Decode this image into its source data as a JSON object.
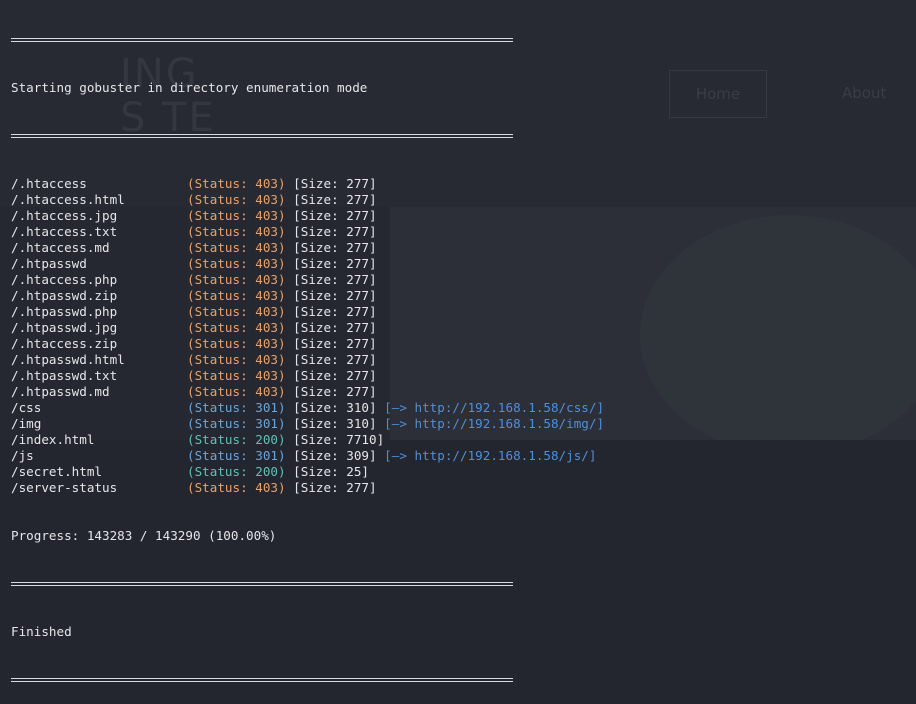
{
  "background": {
    "hero_text_line1": "ING",
    "hero_text_line2": "S TE",
    "nav_home": "Home",
    "nav_about": "About"
  },
  "terminal": {
    "header": "Starting gobuster in directory enumeration mode",
    "results": [
      {
        "path": "/.htaccess",
        "status": "(Status: 403)",
        "code": "403",
        "size": "[Size: 277]",
        "redirect": ""
      },
      {
        "path": "/.htaccess.html",
        "status": "(Status: 403)",
        "code": "403",
        "size": "[Size: 277]",
        "redirect": ""
      },
      {
        "path": "/.htaccess.jpg",
        "status": "(Status: 403)",
        "code": "403",
        "size": "[Size: 277]",
        "redirect": ""
      },
      {
        "path": "/.htaccess.txt",
        "status": "(Status: 403)",
        "code": "403",
        "size": "[Size: 277]",
        "redirect": ""
      },
      {
        "path": "/.htaccess.md",
        "status": "(Status: 403)",
        "code": "403",
        "size": "[Size: 277]",
        "redirect": ""
      },
      {
        "path": "/.htpasswd",
        "status": "(Status: 403)",
        "code": "403",
        "size": "[Size: 277]",
        "redirect": ""
      },
      {
        "path": "/.htaccess.php",
        "status": "(Status: 403)",
        "code": "403",
        "size": "[Size: 277]",
        "redirect": ""
      },
      {
        "path": "/.htpasswd.zip",
        "status": "(Status: 403)",
        "code": "403",
        "size": "[Size: 277]",
        "redirect": ""
      },
      {
        "path": "/.htpasswd.php",
        "status": "(Status: 403)",
        "code": "403",
        "size": "[Size: 277]",
        "redirect": ""
      },
      {
        "path": "/.htpasswd.jpg",
        "status": "(Status: 403)",
        "code": "403",
        "size": "[Size: 277]",
        "redirect": ""
      },
      {
        "path": "/.htaccess.zip",
        "status": "(Status: 403)",
        "code": "403",
        "size": "[Size: 277]",
        "redirect": ""
      },
      {
        "path": "/.htpasswd.html",
        "status": "(Status: 403)",
        "code": "403",
        "size": "[Size: 277]",
        "redirect": ""
      },
      {
        "path": "/.htpasswd.txt",
        "status": "(Status: 403)",
        "code": "403",
        "size": "[Size: 277]",
        "redirect": ""
      },
      {
        "path": "/.htpasswd.md",
        "status": "(Status: 403)",
        "code": "403",
        "size": "[Size: 277]",
        "redirect": ""
      },
      {
        "path": "/css",
        "status": "(Status: 301)",
        "code": "301",
        "size": "[Size: 310]",
        "redirect": "[—> http://192.168.1.58/css/]"
      },
      {
        "path": "/img",
        "status": "(Status: 301)",
        "code": "301",
        "size": "[Size: 310]",
        "redirect": "[—> http://192.168.1.58/img/]"
      },
      {
        "path": "/index.html",
        "status": "(Status: 200)",
        "code": "200",
        "size": "[Size: 7710]",
        "redirect": ""
      },
      {
        "path": "/js",
        "status": "(Status: 301)",
        "code": "301",
        "size": "[Size: 309]",
        "redirect": "[—> http://192.168.1.58/js/]"
      },
      {
        "path": "/secret.html",
        "status": "(Status: 200)",
        "code": "200",
        "size": "[Size: 25]",
        "redirect": ""
      },
      {
        "path": "/server-status",
        "status": "(Status: 403)",
        "code": "403",
        "size": "[Size: 277]",
        "redirect": ""
      }
    ],
    "progress": "Progress: 143283 / 143290 (100.00%)",
    "footer": "Finished"
  },
  "colors": {
    "status_403": "#e8a26a",
    "status_301": "#6aa5dc",
    "status_200": "#5fc2b4",
    "redirect": "#4e8fd8"
  }
}
